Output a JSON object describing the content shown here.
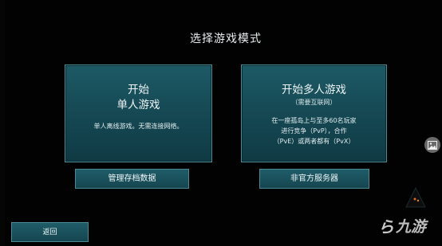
{
  "screen": {
    "title": "选择游戏模式"
  },
  "single_player": {
    "line1": "开始",
    "line2": "单人游戏",
    "description": "单人离线游戏。无需连接网络。"
  },
  "multiplayer": {
    "title": "开始多人游戏",
    "subtitle": "（需要互联网）",
    "desc_line1": "在一座孤岛上与至多60名玩家",
    "desc_line2": "进行竞争（PvP），合作",
    "desc_line3": "（PvE）或两者都有（PvX）"
  },
  "buttons": {
    "manage_saves": "管理存档数据",
    "unofficial_servers": "非官方服务器",
    "back": "返回"
  },
  "watermark": {
    "glyph": "ら",
    "text": "九游"
  },
  "colors": {
    "panel": "#1d5a66",
    "panel_border": "#4e8a96",
    "background": "#000000"
  },
  "icons": {
    "side": "image-icon"
  }
}
